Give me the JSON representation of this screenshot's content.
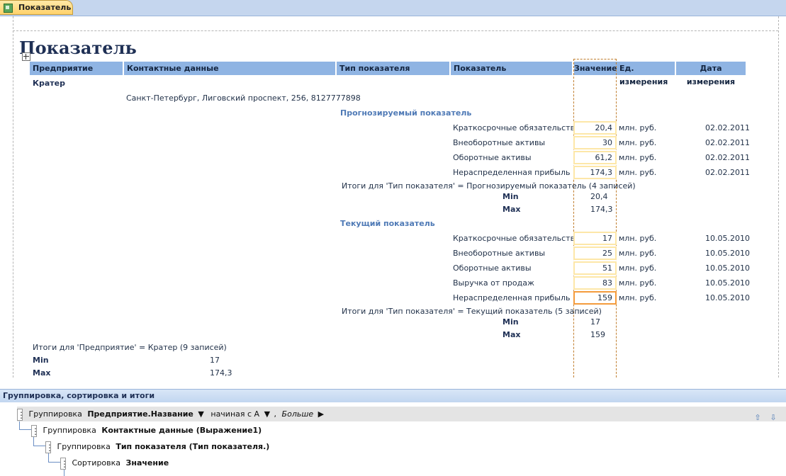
{
  "tab": {
    "label": "Показатель",
    "icon": "report-icon"
  },
  "report": {
    "title": "Показатель",
    "headers": {
      "enterprise": "Предприятие",
      "contacts": "Контактные данные",
      "type": "Тип показателя",
      "indicator": "Показатель",
      "value": "Значение",
      "unit": "Ед. измерения",
      "date": "Дата измерения"
    },
    "enterprise_name": "Кратер",
    "contacts_value": "Санкт-Петербург, Лиговский проспект, 256, 8127777898",
    "groups": [
      {
        "type": "Прогнозируемый показатель",
        "rows": [
          {
            "indicator": "Краткосрочные обязательства",
            "value": "20,4",
            "unit": "млн. руб.",
            "date": "02.02.2011"
          },
          {
            "indicator": "Внеоборотные активы",
            "value": "30",
            "unit": "млн. руб.",
            "date": "02.02.2011"
          },
          {
            "indicator": "Оборотные активы",
            "value": "61,2",
            "unit": "млн. руб.",
            "date": "02.02.2011"
          },
          {
            "indicator": "Нераспределенная прибыль",
            "value": "174,3",
            "unit": "млн. руб.",
            "date": "02.02.2011"
          }
        ],
        "summary": "Итоги для 'Тип показателя' =  Прогнозируемый показатель (4 записей)",
        "min_label": "Min",
        "min": "20,4",
        "max_label": "Max",
        "max": "174,3"
      },
      {
        "type": "Текущий показатель",
        "rows": [
          {
            "indicator": "Краткосрочные обязательства",
            "value": "17",
            "unit": "млн. руб.",
            "date": "10.05.2010"
          },
          {
            "indicator": "Внеоборотные активы",
            "value": "25",
            "unit": "млн. руб.",
            "date": "10.05.2010"
          },
          {
            "indicator": "Оборотные активы",
            "value": "51",
            "unit": "млн. руб.",
            "date": "10.05.2010"
          },
          {
            "indicator": "Выручка от продаж",
            "value": "83",
            "unit": "млн. руб.",
            "date": "10.05.2010"
          },
          {
            "indicator": "Нераспределенная прибыль",
            "value": "159",
            "unit": "млн. руб.",
            "date": "10.05.2010"
          }
        ],
        "summary": "Итоги для 'Тип показателя' =  Текущий показатель (5 записей)",
        "min_label": "Min",
        "min": "17",
        "max_label": "Max",
        "max": "159"
      }
    ],
    "enterprise_summary": "Итоги для 'Предприятие' =  Кратер (9 записей)",
    "enterprise_min_label": "Min",
    "enterprise_min": "17",
    "enterprise_max_label": "Max",
    "enterprise_max": "174,3"
  },
  "grouping_pane": {
    "title": "Группировка, сортировка и итоги",
    "row1": {
      "prefix": "Группировка",
      "field": "Предприятие.Название",
      "order": "начиная с А",
      "more": "Больше"
    },
    "row2": {
      "prefix": "Группировка",
      "field": "Контактные данные (Выражение1)"
    },
    "row3": {
      "prefix": "Группировка",
      "field": "Тип показателя (Тип показателя.)"
    },
    "row4": {
      "prefix": "Сортировка",
      "field": "Значение"
    }
  },
  "colors": {
    "header_bg": "#8fb4e3",
    "group_label": "#4f7ab6",
    "selected_border": "#f49b3c",
    "tab_bg": "#ffd26b"
  }
}
